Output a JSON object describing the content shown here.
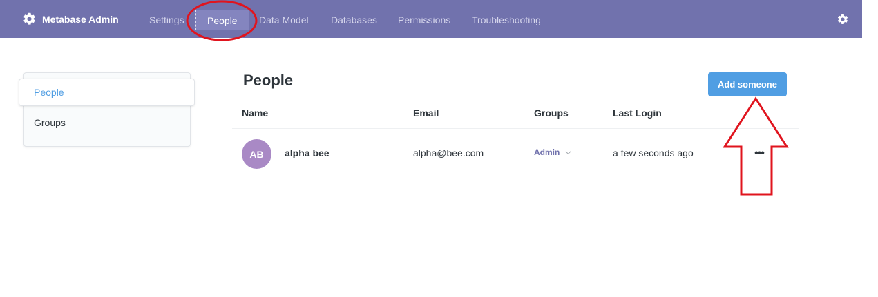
{
  "header": {
    "brand_label": "Metabase Admin",
    "brand_icon": "gear-icon",
    "nav": [
      {
        "label": "Settings"
      },
      {
        "label": "People",
        "active": true
      },
      {
        "label": "Data Model"
      },
      {
        "label": "Databases"
      },
      {
        "label": "Permissions"
      },
      {
        "label": "Troubleshooting"
      }
    ],
    "settings_icon": "gear-icon"
  },
  "sidebar": {
    "items": [
      {
        "label": "People",
        "active": true
      },
      {
        "label": "Groups"
      }
    ]
  },
  "main": {
    "title": "People",
    "add_button_label": "Add someone",
    "columns": [
      "Name",
      "Email",
      "Groups",
      "Last Login"
    ],
    "rows": [
      {
        "initials": "AB",
        "name": "alpha bee",
        "email": "alpha@bee.com",
        "group": "Admin",
        "last_login": "a few seconds ago",
        "actions_icon": "more-horizontal-icon"
      }
    ]
  },
  "colors": {
    "header_bg": "#7172ad",
    "brand_blue": "#509ee3",
    "avatar_bg": "#a989c5",
    "annotation_red": "#e0141e"
  }
}
